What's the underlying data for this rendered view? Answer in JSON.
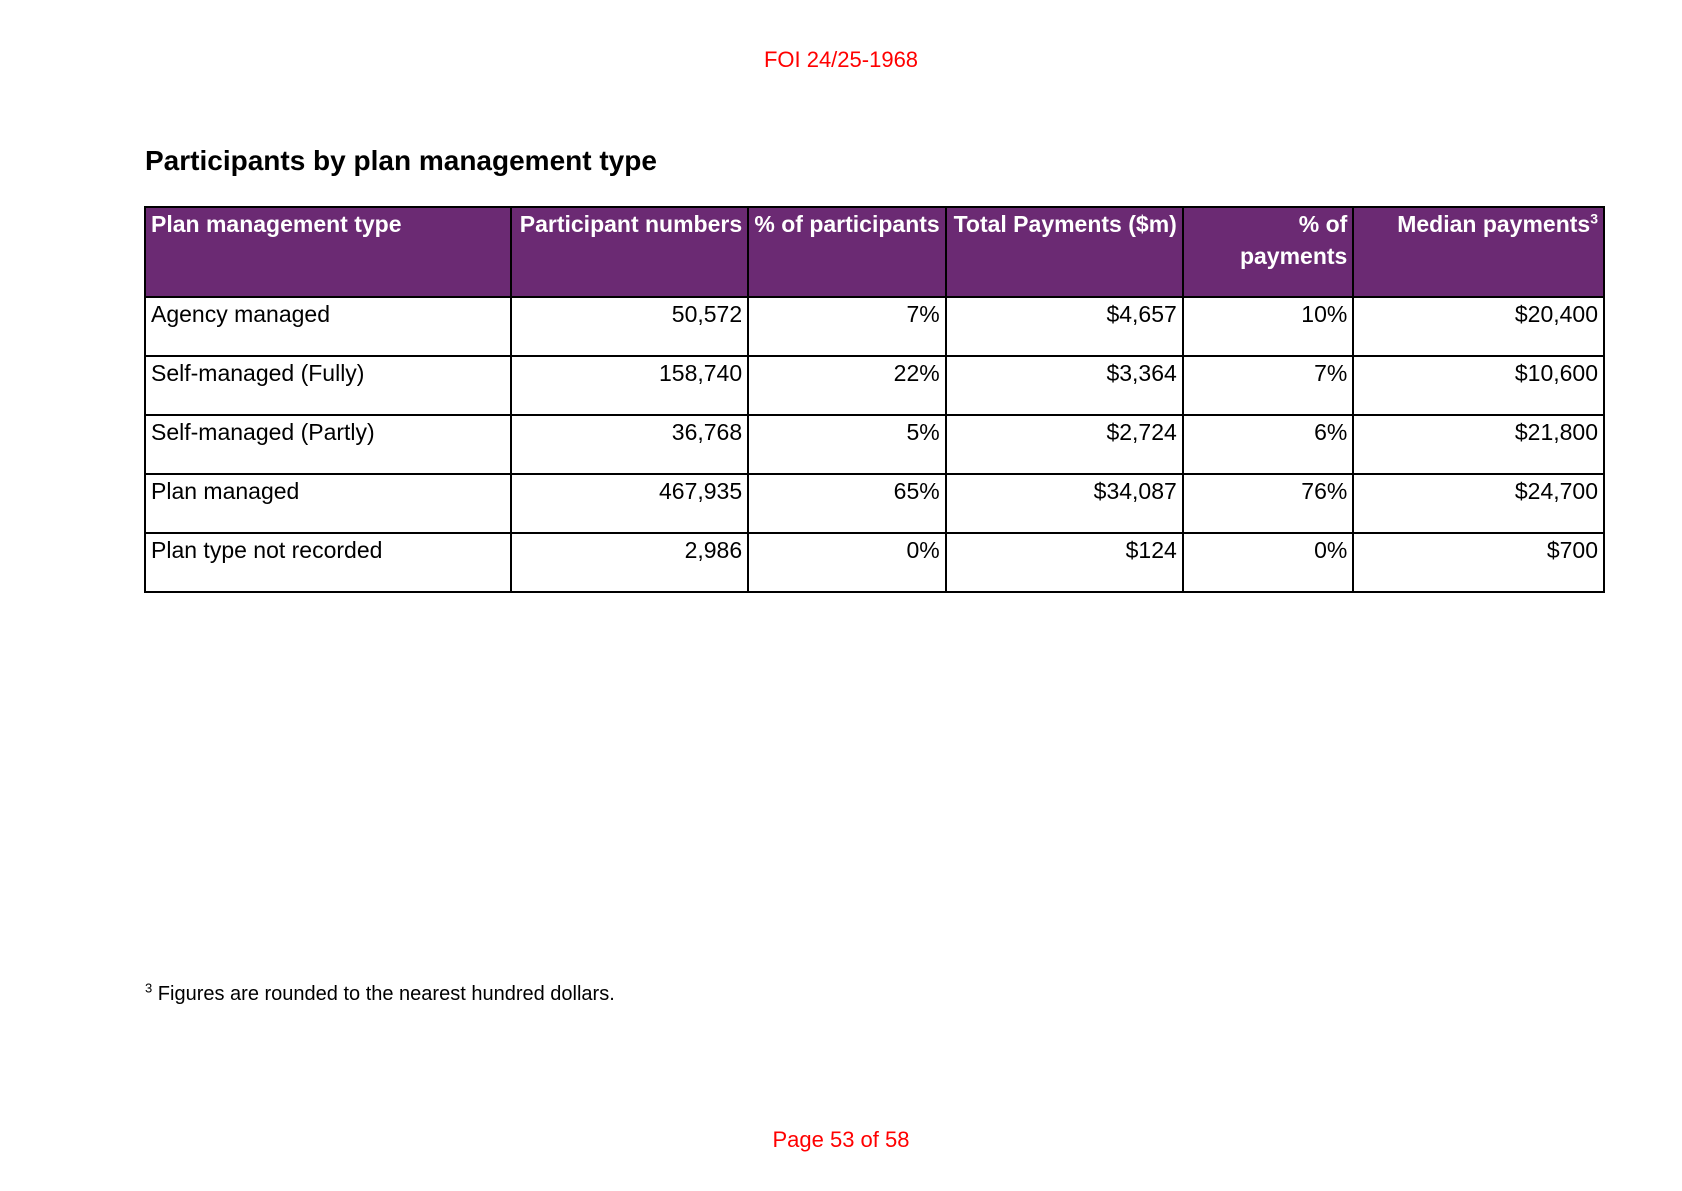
{
  "header": {
    "foi_reference": "FOI 24/25-1968"
  },
  "section": {
    "title": "Participants by plan management type"
  },
  "table": {
    "columns": [
      {
        "label": "Plan management type",
        "align": "left"
      },
      {
        "label": "Participant numbers",
        "align": "right"
      },
      {
        "label": "% of participants",
        "align": "right"
      },
      {
        "label": "Total Payments ($m)",
        "align": "right"
      },
      {
        "label": "% of payments",
        "align": "right"
      },
      {
        "label": "Median payments",
        "footnote_marker": "3",
        "align": "right"
      }
    ],
    "rows": [
      {
        "type": "Agency managed",
        "participants": "50,572",
        "pct_participants": "7%",
        "total_payments": "$4,657",
        "pct_payments": "10%",
        "median_payments": "$20,400"
      },
      {
        "type": "Self-managed (Fully)",
        "participants": "158,740",
        "pct_participants": "22%",
        "total_payments": "$3,364",
        "pct_payments": "7%",
        "median_payments": "$10,600"
      },
      {
        "type": "Self-managed (Partly)",
        "participants": "36,768",
        "pct_participants": "5%",
        "total_payments": "$2,724",
        "pct_payments": "6%",
        "median_payments": "$21,800"
      },
      {
        "type": "Plan managed",
        "participants": "467,935",
        "pct_participants": "65%",
        "total_payments": "$34,087",
        "pct_payments": "76%",
        "median_payments": "$24,700"
      },
      {
        "type": "Plan type not recorded",
        "participants": "2,986",
        "pct_participants": "0%",
        "total_payments": "$124",
        "pct_payments": "0%",
        "median_payments": "$700"
      }
    ],
    "header_color": "#6b2a73"
  },
  "footnote": {
    "marker": "3",
    "text": "Figures are rounded to the nearest hundred dollars."
  },
  "footer": {
    "page_label": "Page 53 of 58"
  },
  "colors": {
    "header_bg": "#6b2a73",
    "watermark_red": "#ff0000"
  }
}
